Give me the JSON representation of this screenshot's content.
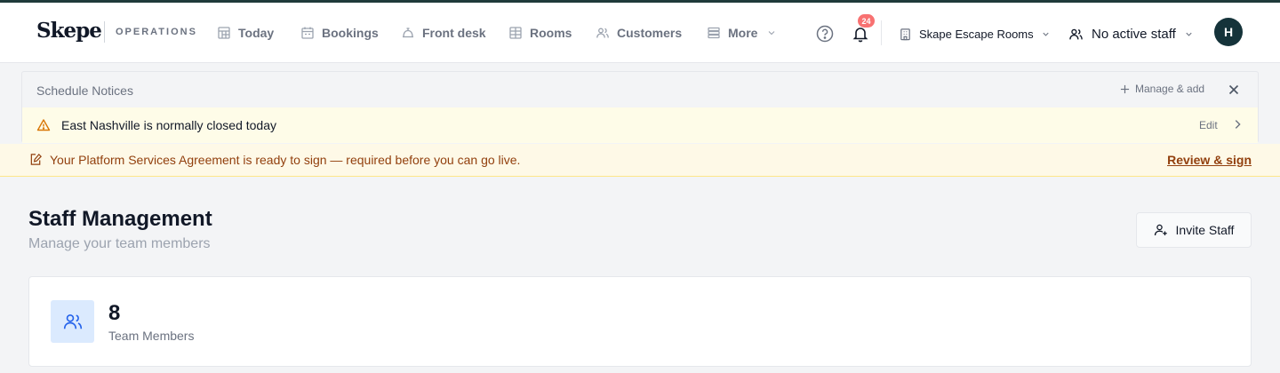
{
  "colors": {
    "accent": "#15333a",
    "badge": "#f87171",
    "warning_text": "#92400e",
    "notice_bg": "#fefce8",
    "stat_icon_bg": "#dbeafe"
  },
  "header": {
    "logo": "Skepe",
    "app_label": "OPERATIONS",
    "nav": [
      {
        "label": "Today",
        "icon": "calendar-grid-icon"
      },
      {
        "label": "Bookings",
        "icon": "calendar-icon"
      },
      {
        "label": "Front desk",
        "icon": "concierge-bell-icon"
      },
      {
        "label": "Rooms",
        "icon": "layout-grid-icon"
      },
      {
        "label": "Customers",
        "icon": "users-icon"
      },
      {
        "label": "More",
        "icon": "list-icon"
      }
    ],
    "notification_count": "24",
    "company": "Skape Escape Rooms",
    "staff_status": "No active staff",
    "avatar_initial": "H"
  },
  "notices": {
    "title": "Schedule Notices",
    "manage_label": "Manage & add",
    "items": [
      {
        "text": "East Nashville is normally closed today",
        "edit_label": "Edit"
      }
    ]
  },
  "agreement": {
    "text": "Your Platform Services Agreement is ready to sign — required before you can go live.",
    "link_label": "Review & sign"
  },
  "page": {
    "title": "Staff Management",
    "subtitle": "Manage your team members",
    "invite_label": "Invite Staff"
  },
  "stats": [
    {
      "value": "8",
      "label": "Team Members",
      "icon": "users-icon"
    }
  ]
}
